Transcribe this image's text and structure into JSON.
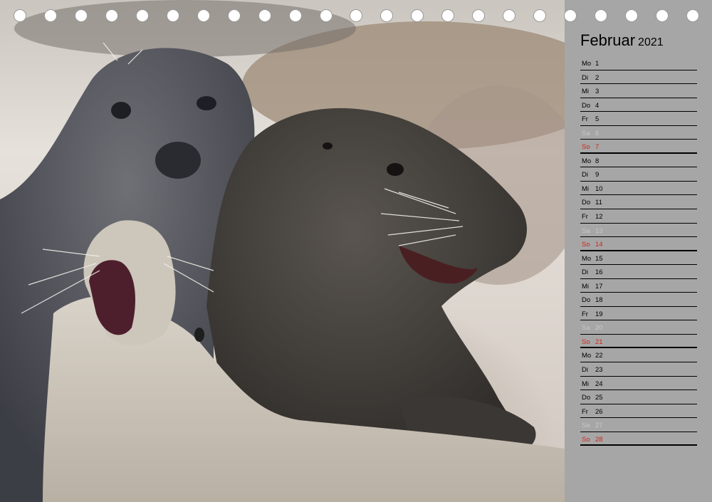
{
  "calendar": {
    "month": "Februar",
    "year": "2021",
    "days": [
      {
        "wd": "Mo",
        "d": "1",
        "type": "weekday"
      },
      {
        "wd": "Di",
        "d": "2",
        "type": "weekday"
      },
      {
        "wd": "Mi",
        "d": "3",
        "type": "weekday"
      },
      {
        "wd": "Do",
        "d": "4",
        "type": "weekday"
      },
      {
        "wd": "Fr",
        "d": "5",
        "type": "weekday"
      },
      {
        "wd": "Sa",
        "d": "6",
        "type": "saturday"
      },
      {
        "wd": "So",
        "d": "7",
        "type": "sunday"
      },
      {
        "wd": "Mo",
        "d": "8",
        "type": "weekday"
      },
      {
        "wd": "Di",
        "d": "9",
        "type": "weekday"
      },
      {
        "wd": "Mi",
        "d": "10",
        "type": "weekday"
      },
      {
        "wd": "Do",
        "d": "11",
        "type": "weekday"
      },
      {
        "wd": "Fr",
        "d": "12",
        "type": "weekday"
      },
      {
        "wd": "Sa",
        "d": "13",
        "type": "saturday"
      },
      {
        "wd": "So",
        "d": "14",
        "type": "sunday"
      },
      {
        "wd": "Mo",
        "d": "15",
        "type": "weekday"
      },
      {
        "wd": "Di",
        "d": "16",
        "type": "weekday"
      },
      {
        "wd": "Mi",
        "d": "17",
        "type": "weekday"
      },
      {
        "wd": "Do",
        "d": "18",
        "type": "weekday"
      },
      {
        "wd": "Fr",
        "d": "19",
        "type": "weekday"
      },
      {
        "wd": "Sa",
        "d": "20",
        "type": "saturday"
      },
      {
        "wd": "So",
        "d": "21",
        "type": "sunday"
      },
      {
        "wd": "Mo",
        "d": "22",
        "type": "weekday"
      },
      {
        "wd": "Di",
        "d": "23",
        "type": "weekday"
      },
      {
        "wd": "Mi",
        "d": "24",
        "type": "weekday"
      },
      {
        "wd": "Do",
        "d": "25",
        "type": "weekday"
      },
      {
        "wd": "Fr",
        "d": "26",
        "type": "weekday"
      },
      {
        "wd": "Sa",
        "d": "27",
        "type": "saturday"
      },
      {
        "wd": "So",
        "d": "28",
        "type": "sunday"
      }
    ]
  },
  "colors": {
    "panel": "#a6a6a6",
    "sunday": "#d0261b",
    "saturday": "#c7c7c7",
    "text": "#000000"
  },
  "photo": {
    "subject": "grey seals on beach"
  },
  "binding": {
    "hole_count": 23
  }
}
